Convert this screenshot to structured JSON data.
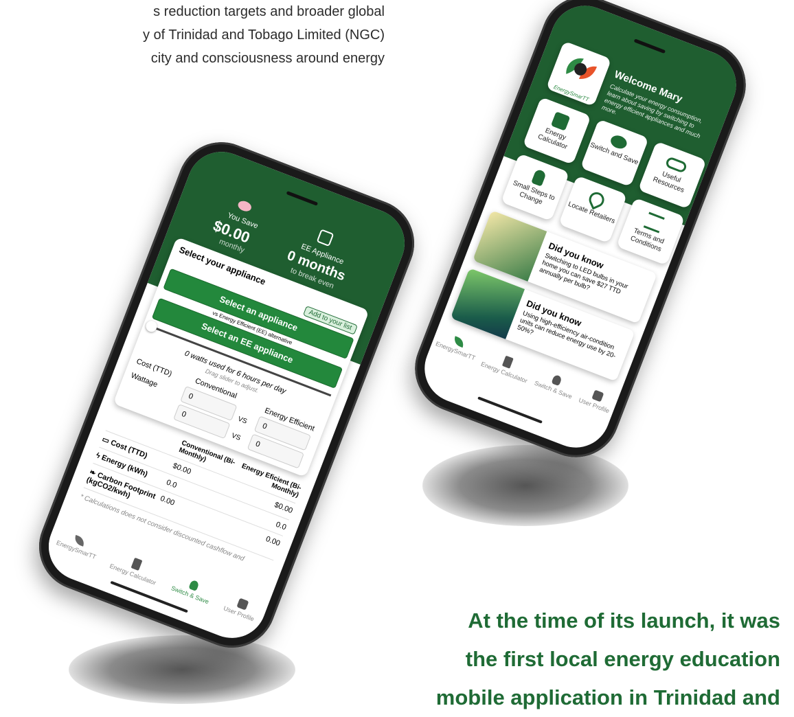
{
  "intro": {
    "line1": "s reduction targets and broader global",
    "line2": "y of Trinidad and Tobago Limited (NGC)",
    "line3": "city and consciousness around energy"
  },
  "tagline": {
    "line1": "At the time of its launch, it was",
    "line2": "the first local energy education",
    "line3": "mobile application in Trinidad and"
  },
  "colors": {
    "brand_green": "#1f5e30",
    "button_green": "#23883c",
    "tagline_green": "#1f6b35"
  },
  "switch_save": {
    "you_save_label": "You Save",
    "you_save_value": "$0.00",
    "you_save_period": "monthly",
    "ee_label": "EE Appliance",
    "ee_value": "0 months",
    "ee_sub": "to break even",
    "select_title": "Select your appliance",
    "add_to_list": "Add to your list",
    "select_appliance": "Select an appliance",
    "vs_label": "vs Energy Efficient (EE) alternative",
    "select_ee": "Select an EE appliance",
    "watts_line": "0 watts used for 6 hours per day",
    "drag_hint": "Drag slider to adjust.",
    "cost_label": "Cost (TTD)",
    "wattage_label": "Wattage",
    "conventional_label": "Conventional",
    "ee_col_label": "Energy Efficient",
    "vs": "VS",
    "conv_cost": "0",
    "conv_watt": "0",
    "ee_cost": "0",
    "ee_watt": "0",
    "table_headers": [
      "Conventional (Bi-Monthly)",
      "Energy Eficient (Bi-Monthly)"
    ],
    "rows": [
      {
        "label": "Cost (TTD)",
        "icon": "money-icon",
        "conv": "$0.00",
        "ee": "$0.00"
      },
      {
        "label": "Energy (kWh)",
        "icon": "bolt-icon",
        "conv": "0.0",
        "ee": "0.0"
      },
      {
        "label": "Carbon Footprint (kgCO2/kwh)",
        "icon": "leaf-icon",
        "conv": "0.00",
        "ee": "0.00"
      }
    ],
    "footnote": "* Calculations does not consider discounted cashflow and",
    "nav": [
      "EnergySmarTT",
      "Energy Calculator",
      "Switch & Save",
      "User Profile"
    ]
  },
  "home": {
    "logo_text": "EnergySmarTT",
    "welcome": "Welcome Mary",
    "welcome_sub": "Calculate your energy consumption, learn about saving by switching to energy efficient appliances and much more.",
    "tiles": [
      "Energy Calculator",
      "Switch and Save",
      "Useful Resources",
      "Small Steps to Change",
      "Locate Retailers",
      "Terms and Conditions"
    ],
    "tile_icons": [
      "calculator-icon",
      "piggy-bank-icon",
      "link-icon",
      "footsteps-icon",
      "location-pin-icon",
      "scales-icon"
    ],
    "did_you_know_1_title": "Did you know",
    "did_you_know_1_text": "Switching to LED bulbs in your home you can save $27 TTD annually per bulb?",
    "did_you_know_2_title": "Did you know",
    "did_you_know_2_text": "Using high-efficiency air-condition units can reduce energy use by 20-50%?",
    "nav": [
      "EnergySmarTT",
      "Energy Calculator",
      "Switch & Save",
      "User Profile"
    ]
  }
}
